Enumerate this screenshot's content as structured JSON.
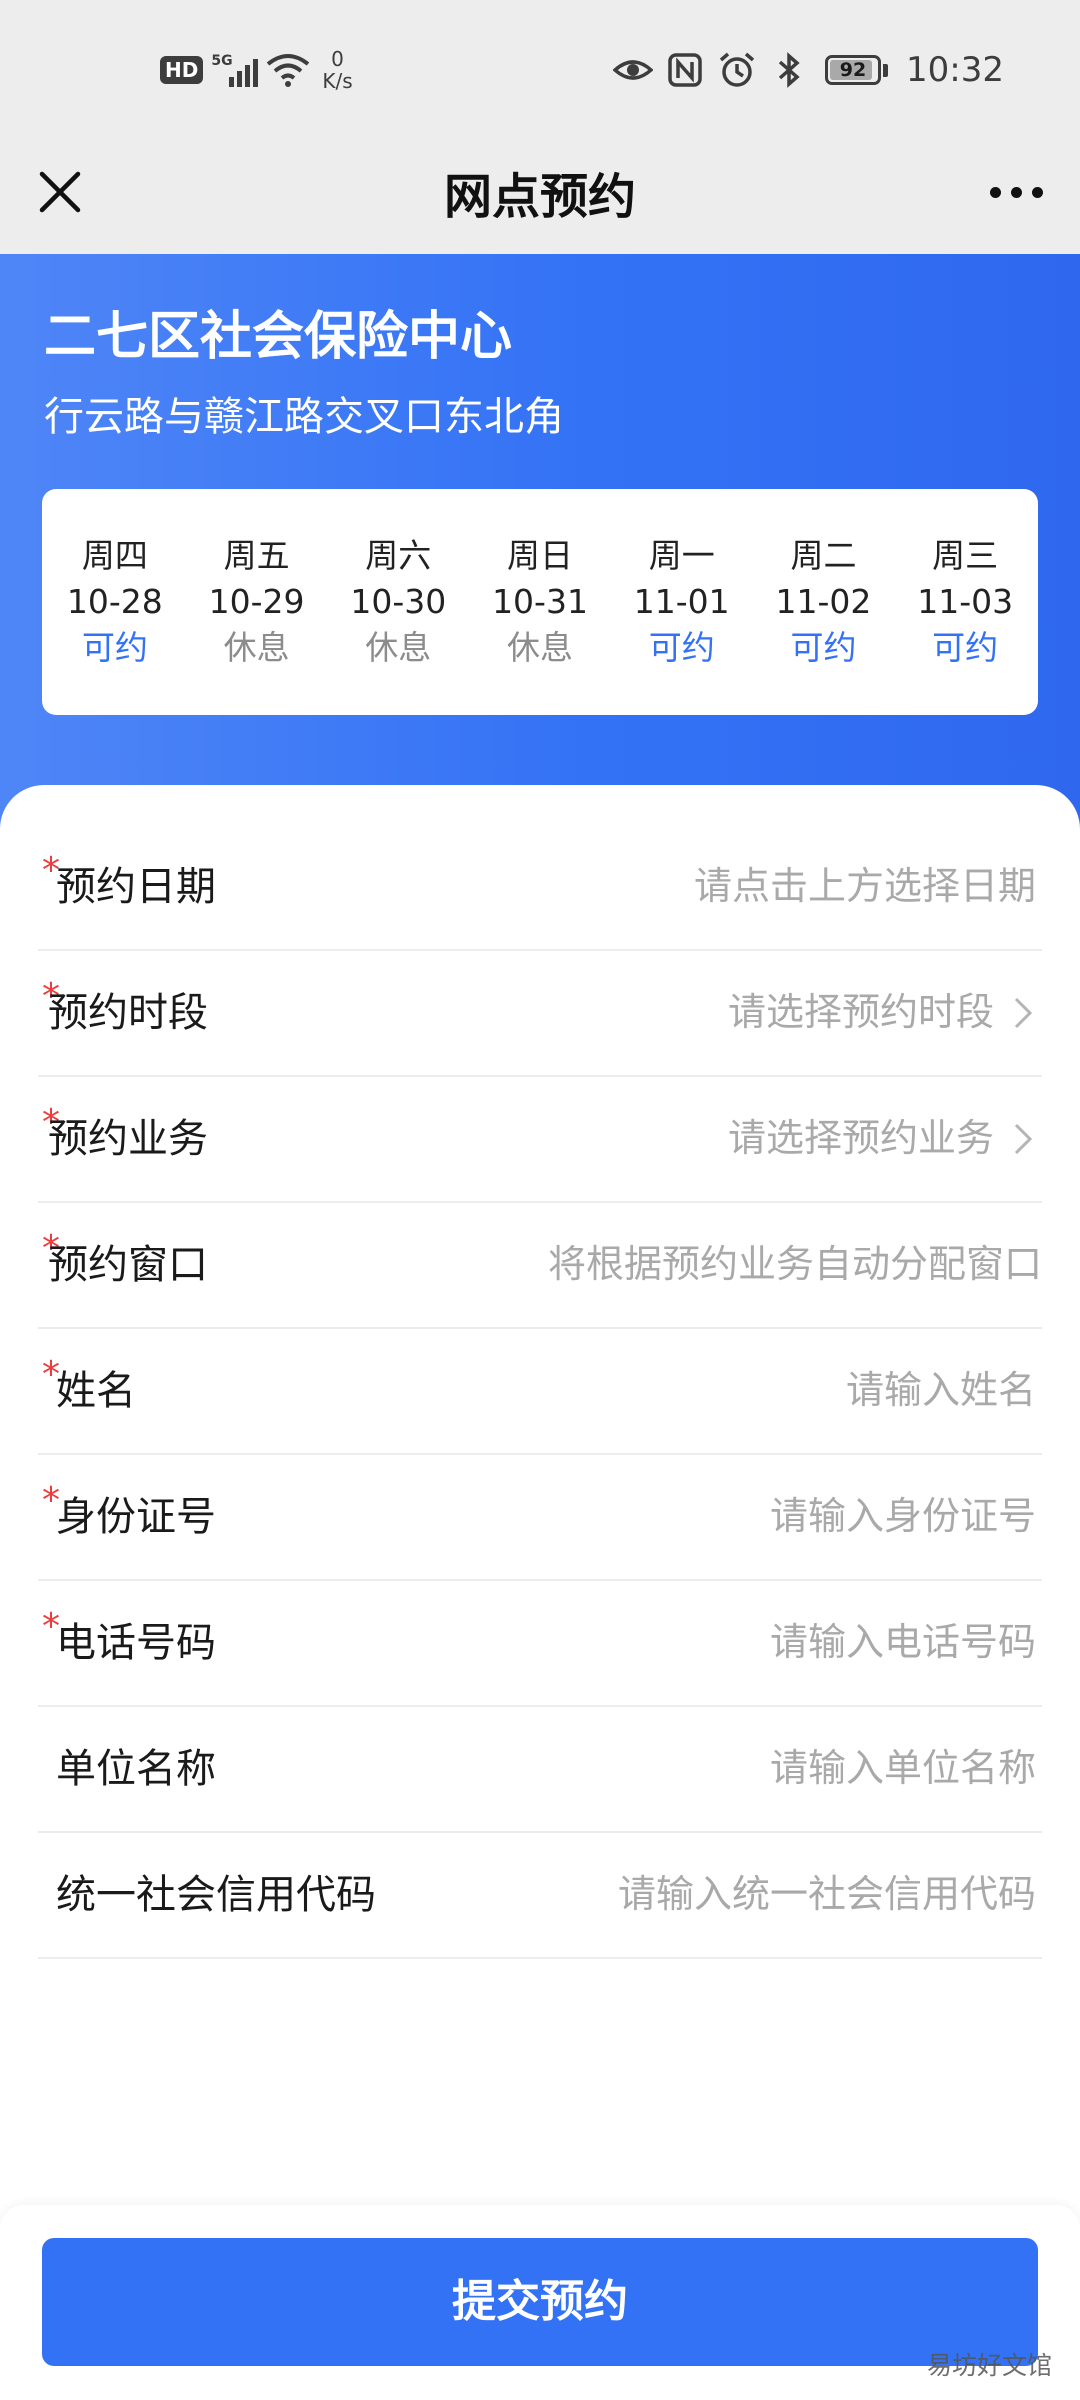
{
  "status_bar": {
    "hd_badge": "HD",
    "network_type": "5G",
    "speed_value": "0",
    "speed_unit": "K/s",
    "battery_level": "92",
    "battery_fraction": 0.92,
    "time": "10:32",
    "icons": [
      "signal-icon",
      "wifi-icon",
      "eye-icon",
      "nfc-icon",
      "alarm-icon",
      "bluetooth-icon",
      "battery-icon"
    ]
  },
  "title_bar": {
    "title": "网点预约",
    "close_icon": "close-icon",
    "more_icon": "more-icon"
  },
  "center": {
    "name": "二七区社会保险中心",
    "address": "行云路与赣江路交叉口东北角"
  },
  "days": [
    {
      "weekday": "周四",
      "date": "10-28",
      "status": "可约",
      "available": true
    },
    {
      "weekday": "周五",
      "date": "10-29",
      "status": "休息",
      "available": false
    },
    {
      "weekday": "周六",
      "date": "10-30",
      "status": "休息",
      "available": false
    },
    {
      "weekday": "周日",
      "date": "10-31",
      "status": "休息",
      "available": false
    },
    {
      "weekday": "周一",
      "date": "11-01",
      "status": "可约",
      "available": true
    },
    {
      "weekday": "周二",
      "date": "11-02",
      "status": "可约",
      "available": true
    },
    {
      "weekday": "周三",
      "date": "11-03",
      "status": "可约",
      "available": true
    }
  ],
  "form": {
    "required_mark": "*",
    "fields": [
      {
        "label": "预约日期",
        "placeholder": "请点击上方选择日期",
        "required": true,
        "value": ""
      },
      {
        "label": "预约时段",
        "placeholder": "请选择预约时段",
        "required": true,
        "value": ""
      },
      {
        "label": "预约业务",
        "placeholder": "请选择预约业务",
        "required": true,
        "value": ""
      },
      {
        "label": "预约窗口",
        "placeholder": "将根据预约业务自动分配窗口",
        "required": true,
        "value": ""
      },
      {
        "label": "姓名",
        "placeholder": "请输入姓名",
        "required": true,
        "value": ""
      },
      {
        "label": "身份证号",
        "placeholder": "请输入身份证号",
        "required": true,
        "value": ""
      },
      {
        "label": "电话号码",
        "placeholder": "请输入电话号码",
        "required": true,
        "value": ""
      },
      {
        "label": "单位名称",
        "placeholder": "请输入单位名称",
        "required": false,
        "value": ""
      },
      {
        "label": "统一社会信用代码",
        "placeholder": "请输入统一社会信用代码",
        "required": false,
        "value": ""
      }
    ]
  },
  "submit": {
    "label": "提交预约"
  },
  "watermark": "易坊好文馆",
  "colors": {
    "accent": "#3372f5",
    "available": "#3372f5",
    "rest": "#8c8c8c",
    "required": "#ee3b3b",
    "placeholder": "#a9a9a9"
  }
}
